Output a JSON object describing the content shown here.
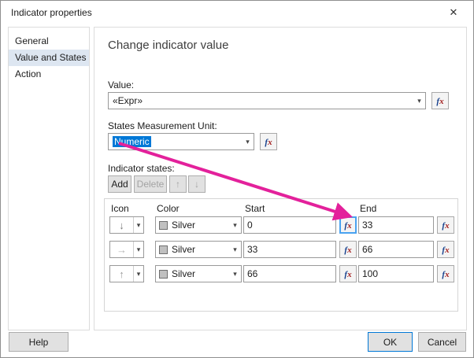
{
  "window": {
    "title": "Indicator properties",
    "close_icon": "✕"
  },
  "sidebar": {
    "items": [
      {
        "label": "General",
        "selected": false
      },
      {
        "label": "Value and States",
        "selected": true
      },
      {
        "label": "Action",
        "selected": false
      }
    ]
  },
  "main": {
    "heading": "Change indicator value",
    "value": {
      "label": "Value:",
      "value": "«Expr»"
    },
    "unit": {
      "label": "States Measurement Unit:",
      "value": "Numeric"
    },
    "states": {
      "label": "Indicator states:",
      "add_button": "Add",
      "delete_button": "Delete",
      "up_icon": "↑",
      "down_icon": "↓",
      "table": {
        "headers": {
          "icon": "Icon",
          "color": "Color",
          "start": "Start",
          "end": "End"
        },
        "rows": [
          {
            "icon_name": "down-arrow",
            "icon_glyph": "↓",
            "color": "Silver",
            "start": "0",
            "end": "33"
          },
          {
            "icon_name": "right-arrow",
            "icon_glyph": "→",
            "color": "Silver",
            "start": "33",
            "end": "66"
          },
          {
            "icon_name": "up-arrow",
            "icon_glyph": "↑",
            "color": "Silver",
            "start": "66",
            "end": "100"
          }
        ]
      }
    }
  },
  "footer": {
    "help": "Help",
    "ok": "OK",
    "cancel": "Cancel"
  },
  "icons": {
    "chevron_down": "▾",
    "fx_f": "f",
    "fx_x": "x"
  },
  "colors": {
    "accent": "#0078d7",
    "selection": "#0078d7",
    "annotation_arrow": "#e3219b",
    "silver_swatch": "#c0c0c0",
    "fx_highlight_border": "#49a2f0"
  }
}
